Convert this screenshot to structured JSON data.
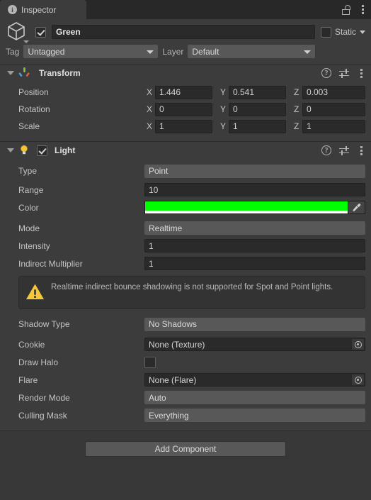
{
  "window": {
    "tab_label": "Inspector",
    "tab_icon": "info-icon",
    "lock_icon": "lock-open-icon",
    "menu_icon": "kebab-menu-icon"
  },
  "object_header": {
    "icon": "cube-icon",
    "enabled": true,
    "name": "Green",
    "static_label": "Static",
    "static_checked": false,
    "tag_label": "Tag",
    "tag_value": "Untagged",
    "layer_label": "Layer",
    "layer_value": "Default"
  },
  "transform": {
    "title": "Transform",
    "icon": "transform-axis-icon",
    "rows": [
      {
        "label": "Position",
        "x": "1.446",
        "y": "0.541",
        "z": "0.003"
      },
      {
        "label": "Rotation",
        "x": "0",
        "y": "0",
        "z": "0"
      },
      {
        "label": "Scale",
        "x": "1",
        "y": "1",
        "z": "1"
      }
    ],
    "axis_labels": {
      "x": "X",
      "y": "Y",
      "z": "Z"
    }
  },
  "light": {
    "title": "Light",
    "icon": "light-bulb-icon",
    "enabled": true,
    "type_label": "Type",
    "type_value": "Point",
    "range_label": "Range",
    "range_value": "10",
    "color_label": "Color",
    "color_value": "#00ff00",
    "color_alpha_hex": "#ffffff",
    "eyedropper_icon": "eyedropper-icon",
    "mode_label": "Mode",
    "mode_value": "Realtime",
    "intensity_label": "Intensity",
    "intensity_value": "1",
    "indirect_label": "Indirect Multiplier",
    "indirect_value": "1",
    "warning": {
      "icon": "warning-triangle-icon",
      "color": "#f7c73a",
      "text": "Realtime indirect bounce shadowing is not supported for Spot and Point lights."
    },
    "shadow_type_label": "Shadow Type",
    "shadow_type_value": "No Shadows",
    "cookie_label": "Cookie",
    "cookie_value": "None (Texture)",
    "draw_halo_label": "Draw Halo",
    "draw_halo_checked": false,
    "flare_label": "Flare",
    "flare_value": "None (Flare)",
    "render_mode_label": "Render Mode",
    "render_mode_value": "Auto",
    "culling_mask_label": "Culling Mask",
    "culling_mask_value": "Everything"
  },
  "component_header_icons": {
    "help": "?",
    "preset": "preset-icon",
    "menu": "kebab-menu-icon"
  },
  "footer": {
    "add_component_label": "Add Component"
  }
}
